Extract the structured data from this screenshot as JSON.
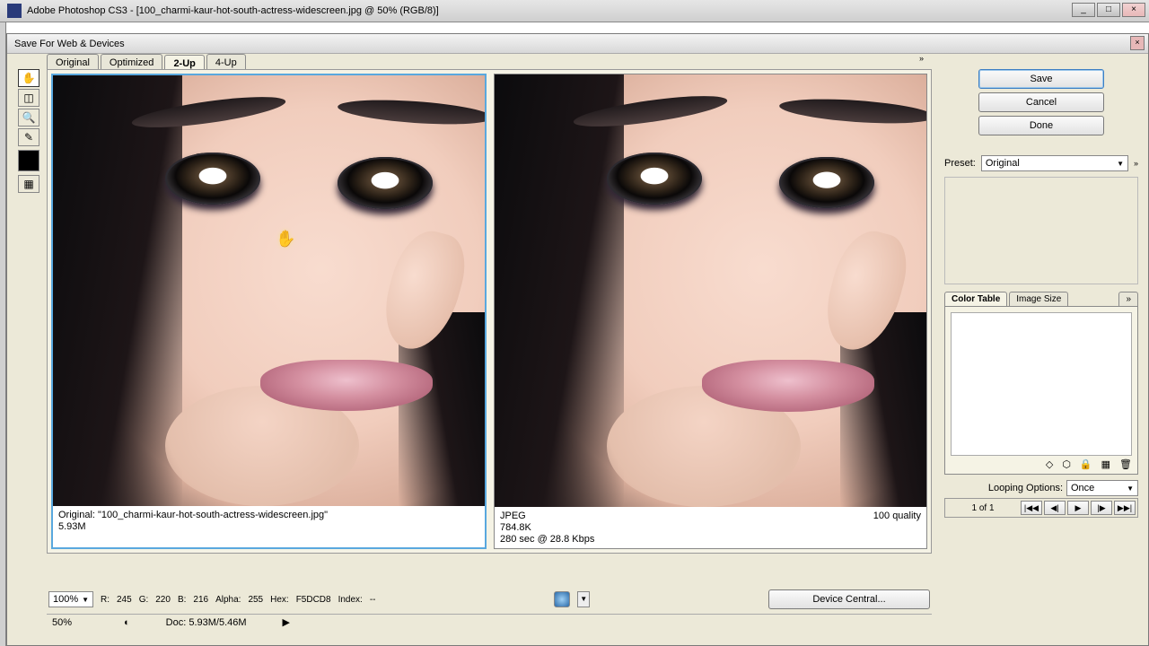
{
  "app": {
    "title": "Adobe Photoshop CS3 - [100_charmi-kaur-hot-south-actress-widescreen.jpg @ 50% (RGB/8)]"
  },
  "dialog": {
    "title": "Save For Web & Devices",
    "tabs": [
      "Original",
      "Optimized",
      "2-Up",
      "4-Up"
    ],
    "active_tab": "2-Up"
  },
  "pane_left": {
    "line1": "Original: \"100_charmi-kaur-hot-south-actress-widescreen.jpg\"",
    "line2": "5.93M"
  },
  "pane_right": {
    "line1": "JPEG",
    "line2": "784.8K",
    "line3": "280 sec @ 28.8 Kbps",
    "quality": "100 quality"
  },
  "right": {
    "buttons": {
      "save": "Save",
      "cancel": "Cancel",
      "done": "Done"
    },
    "preset_label": "Preset:",
    "preset_value": "Original",
    "tabs2": [
      "Color Table",
      "Image Size"
    ],
    "tabs2_active": "Color Table",
    "loop_label": "Looping Options:",
    "loop_value": "Once",
    "frames_label": "1 of 1"
  },
  "status": {
    "zoom": "100%",
    "r_label": "R:",
    "r": "245",
    "g_label": "G:",
    "g": "220",
    "b_label": "B:",
    "b": "216",
    "alpha_label": "Alpha:",
    "alpha": "255",
    "hex_label": "Hex:",
    "hex": "F5DCD8",
    "index_label": "Index:",
    "index": "--",
    "device_central": "Device Central..."
  },
  "bottom": {
    "zoom": "50%",
    "doc": "Doc: 5.93M/5.46M"
  }
}
